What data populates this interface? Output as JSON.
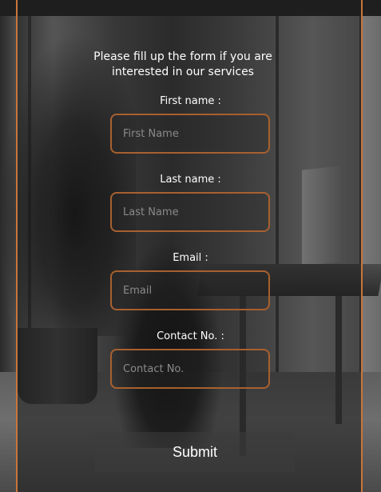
{
  "form": {
    "intro": "Please fill up the form if you are interested in our services",
    "fields": [
      {
        "label": "First name :",
        "placeholder": "First Name",
        "value": ""
      },
      {
        "label": "Last name :",
        "placeholder": "Last Name",
        "value": ""
      },
      {
        "label": "Email :",
        "placeholder": "Email",
        "value": ""
      },
      {
        "label": "Contact No. :",
        "placeholder": "Contact No.",
        "value": ""
      }
    ],
    "submit_label": "Submit"
  },
  "colors": {
    "accent": "#c8753a",
    "text": "#ffffff",
    "placeholder": "#8a8a8a"
  }
}
